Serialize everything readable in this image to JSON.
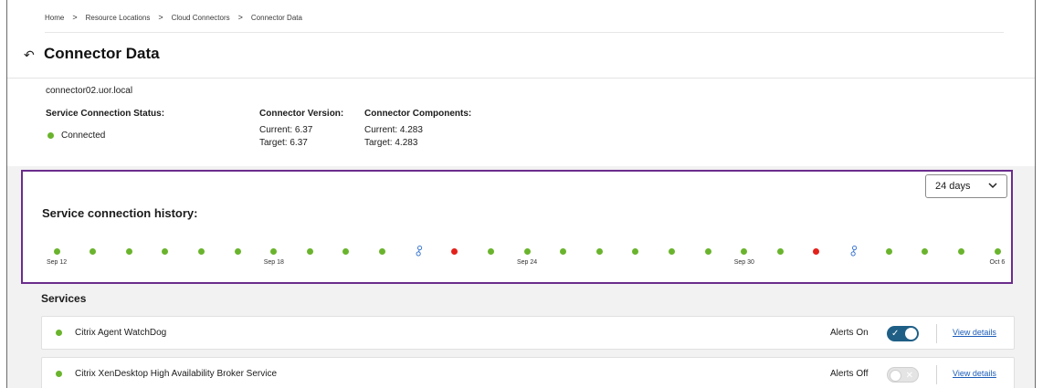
{
  "breadcrumb": [
    {
      "label": "Home"
    },
    {
      "label": "Resource Locations"
    },
    {
      "label": "Cloud Connectors"
    },
    {
      "label": "Connector Data"
    }
  ],
  "breadcrumb_separator": ">",
  "page_title": "Connector Data",
  "back_icon": "back-arrow-icon",
  "connector": {
    "name": "connector02.uor.local",
    "status_label": "Service Connection Status:",
    "status_value": "Connected",
    "version_label": "Connector Version:",
    "version_current": "Current: 6.37",
    "version_target": "Target: 6.37",
    "components_label": "Connector Components:",
    "components_current": "Current: 4.283",
    "components_target": "Target: 4.283"
  },
  "history": {
    "title": "Service connection history:",
    "range_select": "24 days",
    "range_icon": "chevron-down-icon",
    "colors": {
      "connected": "#6ab42d",
      "disconnected": "#e3211b",
      "reconnect": "#2f6fcf"
    },
    "events": [
      {
        "type": "connected",
        "label": "Sep 12"
      },
      {
        "type": "connected",
        "label": ""
      },
      {
        "type": "connected",
        "label": ""
      },
      {
        "type": "connected",
        "label": ""
      },
      {
        "type": "connected",
        "label": ""
      },
      {
        "type": "connected",
        "label": ""
      },
      {
        "type": "connected",
        "label": "Sep 18"
      },
      {
        "type": "connected",
        "label": ""
      },
      {
        "type": "connected",
        "label": ""
      },
      {
        "type": "connected",
        "label": ""
      },
      {
        "type": "reconnect",
        "label": ""
      },
      {
        "type": "disconnected",
        "label": ""
      },
      {
        "type": "connected",
        "label": ""
      },
      {
        "type": "connected",
        "label": "Sep 24"
      },
      {
        "type": "connected",
        "label": ""
      },
      {
        "type": "connected",
        "label": ""
      },
      {
        "type": "connected",
        "label": ""
      },
      {
        "type": "connected",
        "label": ""
      },
      {
        "type": "connected",
        "label": ""
      },
      {
        "type": "connected",
        "label": "Sep 30"
      },
      {
        "type": "connected",
        "label": ""
      },
      {
        "type": "disconnected",
        "label": ""
      },
      {
        "type": "reconnect",
        "label": ""
      },
      {
        "type": "connected",
        "label": ""
      },
      {
        "type": "connected",
        "label": ""
      },
      {
        "type": "connected",
        "label": ""
      },
      {
        "type": "connected",
        "label": "Oct 6"
      }
    ]
  },
  "services": {
    "title": "Services",
    "items": [
      {
        "name": "Citrix Agent WatchDog",
        "alerts_label": "Alerts On",
        "alerts_on": true,
        "link": "View details"
      },
      {
        "name": "Citrix XenDesktop High Availability Broker Service",
        "alerts_label": "Alerts Off",
        "alerts_on": false,
        "link": "View details"
      }
    ]
  }
}
